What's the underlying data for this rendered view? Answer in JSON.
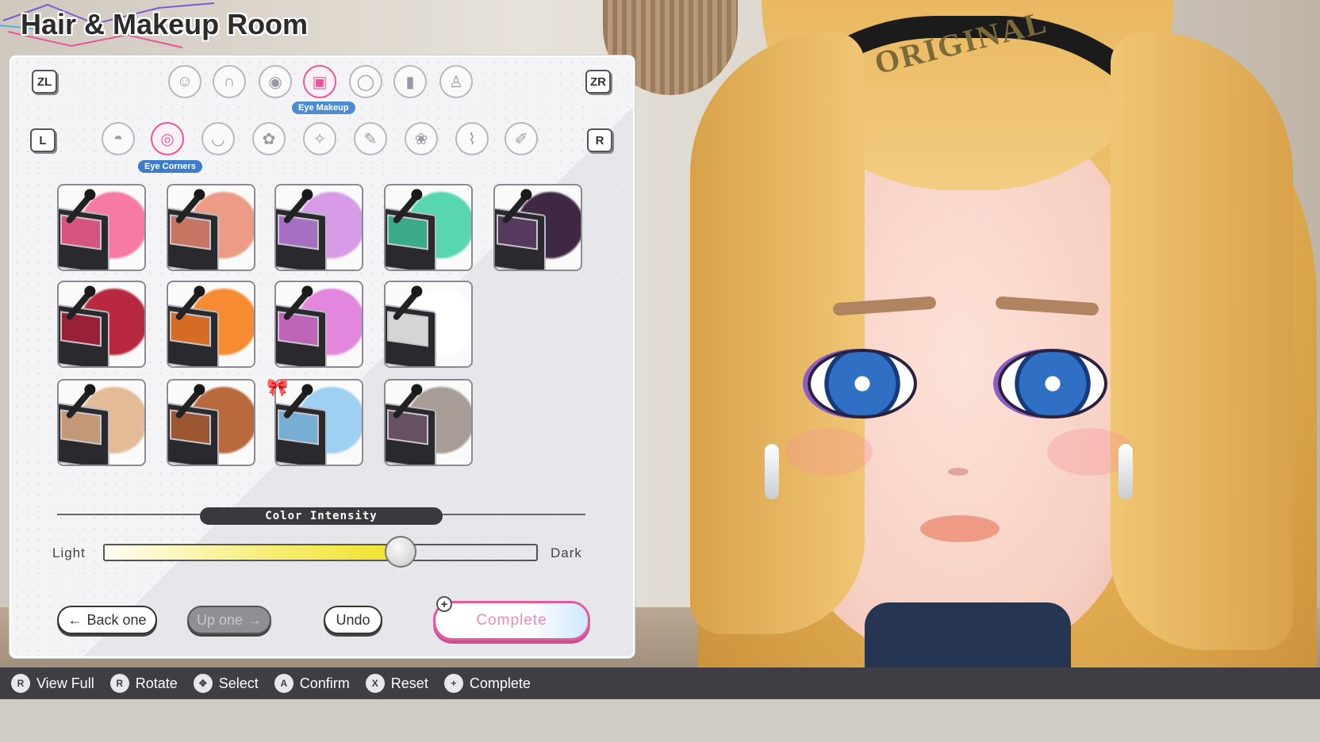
{
  "title": "Hair & Makeup Room",
  "shoulder_keys": {
    "zl": "ZL",
    "zr": "ZR",
    "l": "L",
    "r": "R"
  },
  "category_tabs": {
    "active_label": "Eye Makeup",
    "items": [
      {
        "icon": "face-icon",
        "glyph": "☺"
      },
      {
        "icon": "hair-icon",
        "glyph": "∩"
      },
      {
        "icon": "eye-icon",
        "glyph": "◉"
      },
      {
        "icon": "eye-makeup-icon",
        "glyph": "▣"
      },
      {
        "icon": "lens-icon",
        "glyph": "◯"
      },
      {
        "icon": "lipstick-icon",
        "glyph": "▮"
      },
      {
        "icon": "nail-polish-icon",
        "glyph": "♙"
      }
    ]
  },
  "sub_tabs": {
    "active_label": "Eye Corners",
    "items": [
      {
        "icon": "eyeshadow-icon",
        "glyph": "◓"
      },
      {
        "icon": "eye-corner-icon",
        "glyph": "◎"
      },
      {
        "icon": "eyeliner-icon",
        "glyph": "◡"
      },
      {
        "icon": "eye-glitter-icon",
        "glyph": "✿"
      },
      {
        "icon": "eye-sparkle-icon",
        "glyph": "✧"
      },
      {
        "icon": "eyebrow-brush-icon",
        "glyph": "✎"
      },
      {
        "icon": "eye-decoration-icon",
        "glyph": "❀"
      },
      {
        "icon": "mascara-icon",
        "glyph": "⌇"
      },
      {
        "icon": "eye-pencil-icon",
        "glyph": "✐"
      }
    ]
  },
  "swatches": [
    {
      "color": "#f77aa4",
      "palette": "#e85a87"
    },
    {
      "color": "#ec9c86",
      "palette": "#d87f6a"
    },
    {
      "color": "#d89be7",
      "palette": "#b577d1"
    },
    {
      "color": "#58d6b2",
      "palette": "#3cb895"
    },
    {
      "color": "#3e2844",
      "palette": "#5a3c63"
    },
    {
      "color": "#b8283e",
      "palette": "#a51f38"
    },
    {
      "color": "#f78b32",
      "palette": "#e87426"
    },
    {
      "color": "#e386de",
      "palette": "#cf6cc9"
    },
    {
      "color": "#ffffff",
      "palette": "#e8e8e8"
    },
    {
      "color": "#e3bb97",
      "palette": "#d4a581"
    },
    {
      "color": "#b86a3d",
      "palette": "#a85c33"
    },
    {
      "color": "#9ed0f2",
      "palette": "#7fbde6"
    },
    {
      "color": "#a79c96",
      "palette": "#6d5668"
    }
  ],
  "color_intensity": {
    "label": "Color Intensity",
    "min_label": "Light",
    "max_label": "Dark",
    "value": 0.69
  },
  "buttons": {
    "back_one": "Back one",
    "up_one": "Up one",
    "undo": "Undo",
    "complete": "Complete",
    "plus_symbol": "+"
  },
  "character": {
    "headband_text": "ORIGINAL"
  },
  "hints": [
    {
      "key": "R",
      "label": "View Full",
      "icon": "r-stick-press-icon"
    },
    {
      "key": "R",
      "label": "Rotate",
      "icon": "r-stick-rotate-icon"
    },
    {
      "key": "✥",
      "label": "Select",
      "icon": "dpad-icon"
    },
    {
      "key": "A",
      "label": "Confirm",
      "icon": "a-button-icon"
    },
    {
      "key": "X",
      "label": "Reset",
      "icon": "x-button-icon"
    },
    {
      "key": "+",
      "label": "Complete",
      "icon": "plus-button-icon"
    }
  ],
  "colors": {
    "accent": "#e8569b",
    "tab_label": "#3d7cc9",
    "hint_bar": "#3e3e44"
  }
}
